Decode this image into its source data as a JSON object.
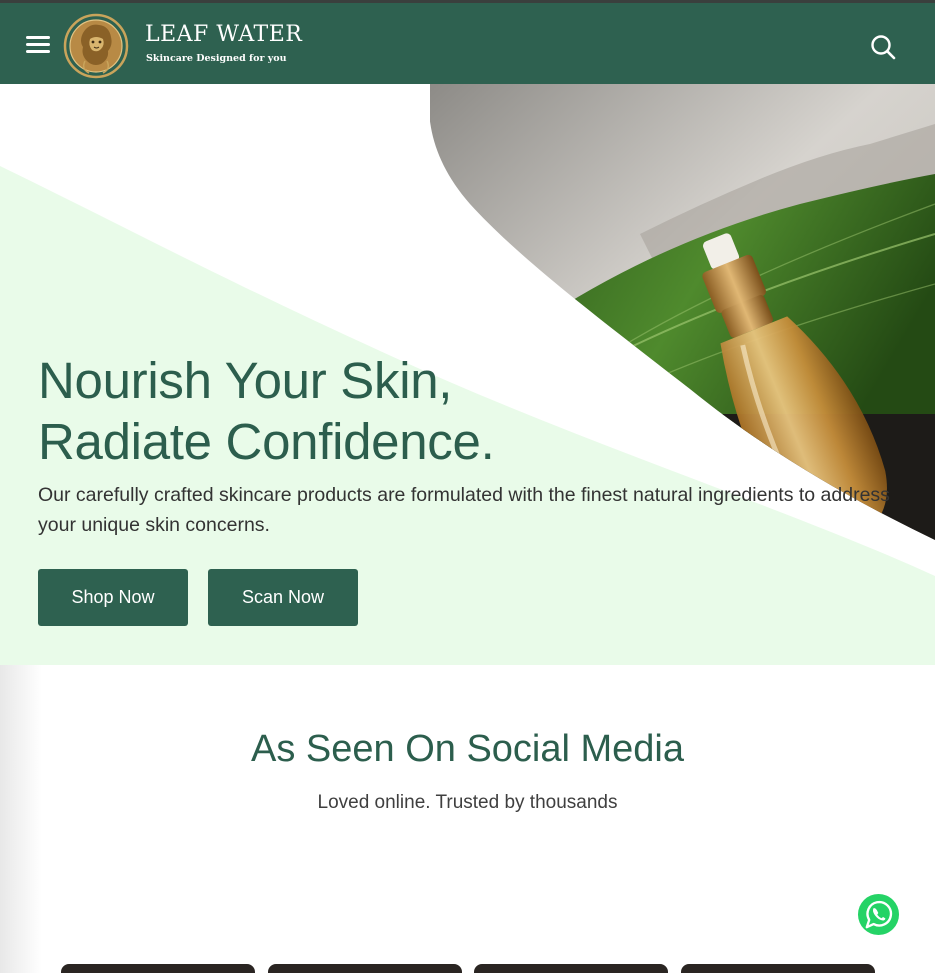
{
  "header": {
    "brand_name": "LEAF WATER",
    "brand_tagline": "Skincare Designed for you",
    "menu_icon": "hamburger-menu-icon",
    "search_icon": "search-icon",
    "logo_icon": "lion-emblem-icon"
  },
  "hero": {
    "title_line1": "Nourish Your Skin,",
    "title_line2": "Radiate Confidence.",
    "description": "Our carefully crafted skincare products are formulated with the finest natural ingredients to address your unique skin concerns.",
    "shop_button": "Shop Now",
    "scan_button": "Scan Now",
    "image_icon": "serum-bottle-with-leaf-image"
  },
  "social": {
    "title": "As Seen On Social Media",
    "subtitle": "Loved online. Trusted by thousands"
  },
  "floating": {
    "whatsapp_icon": "whatsapp-icon"
  },
  "colors": {
    "primary": "#2e6150",
    "heading": "#2c5e4d",
    "hero_tint": "#e9fbe9",
    "accent_gold": "#c9a45b",
    "whatsapp": "#25d366"
  }
}
